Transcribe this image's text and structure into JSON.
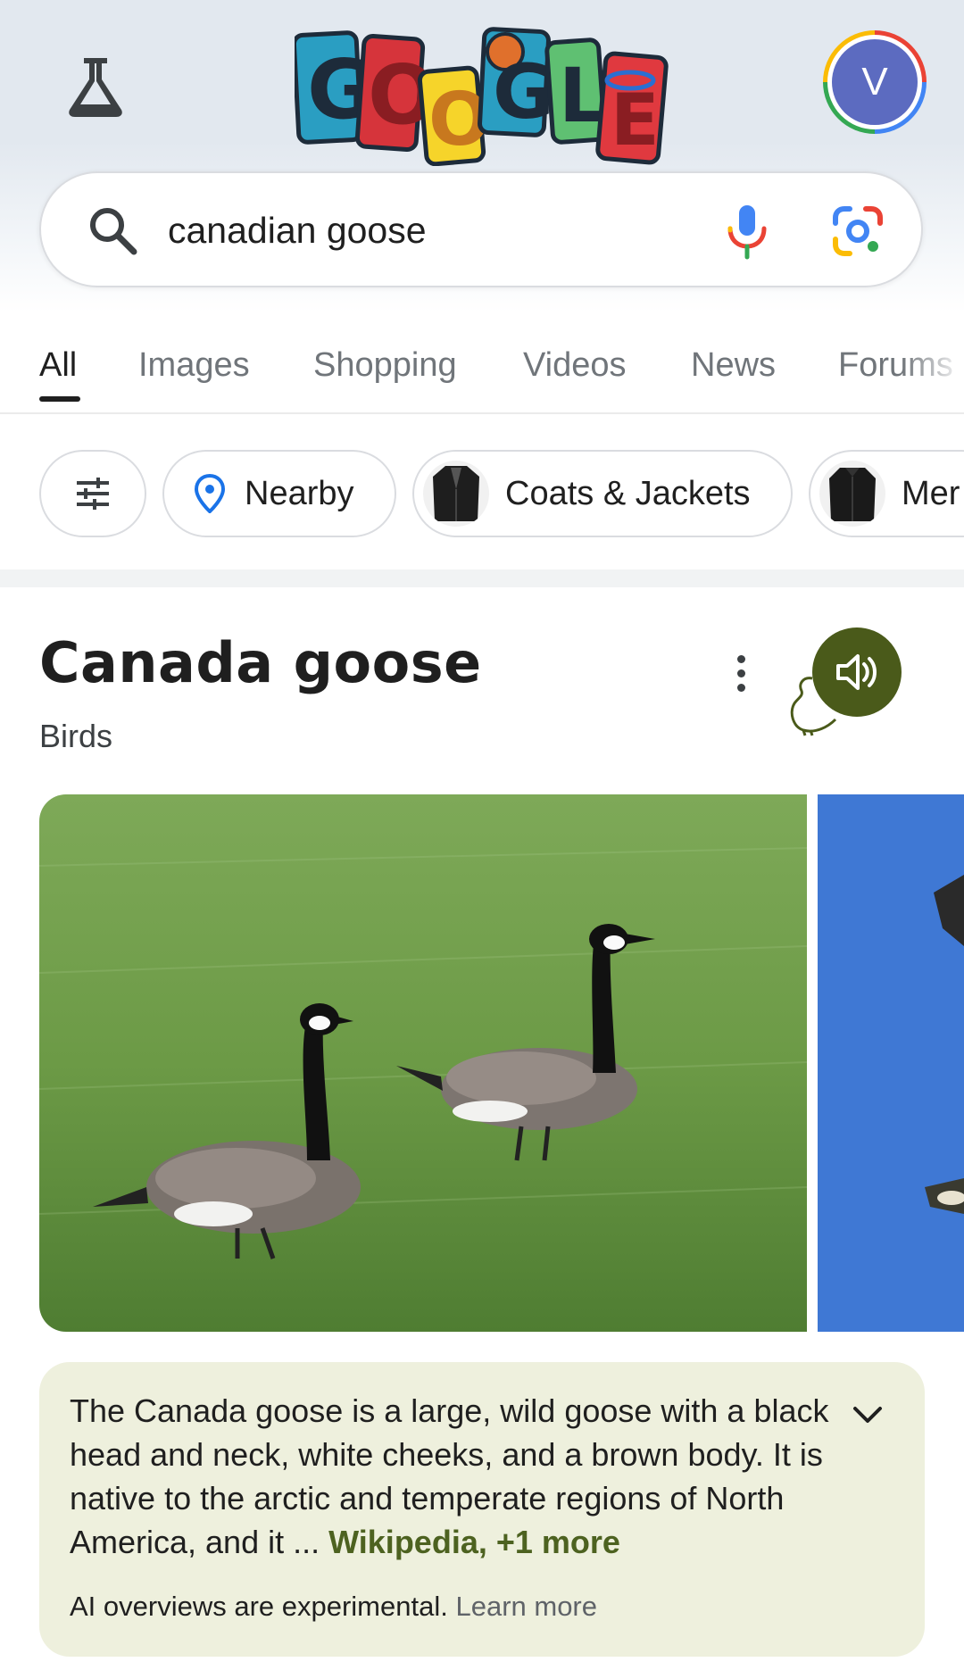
{
  "header": {
    "labs_icon": "flask-icon",
    "doodle_alt": "Google",
    "avatar_letter": "V",
    "avatar_color": "#5c6bc0"
  },
  "search": {
    "query": "canadian goose",
    "search_icon": "search-icon",
    "mic_icon": "mic-icon",
    "lens_icon": "google-lens-icon"
  },
  "tabs": [
    {
      "label": "All",
      "active": true
    },
    {
      "label": "Images"
    },
    {
      "label": "Shopping"
    },
    {
      "label": "Videos"
    },
    {
      "label": "News"
    },
    {
      "label": "Forums"
    }
  ],
  "chips": [
    {
      "label": "",
      "icon": "filter-sliders-icon"
    },
    {
      "label": "Nearby",
      "icon": "location-pin-icon"
    },
    {
      "label": "Coats & Jackets",
      "icon": "jacket-thumbnail"
    },
    {
      "label": "Mer",
      "icon": "jacket-thumbnail"
    }
  ],
  "knowledge_panel": {
    "title": "Canada goose",
    "subtitle": "Birds",
    "more_icon": "more-vert-icon",
    "audio_icon": "volume-icon"
  },
  "ai_overview": {
    "text": "The Canada goose is a large, wild goose with a black head and neck, white cheeks, and a brown body. It is native to the arctic and temperate regions of North America, and it",
    "ellipsis": " ... ",
    "source_link": "Wikipedia, +1 more",
    "note": "AI overviews are experimental.",
    "learn_more": "Learn more",
    "background_color": "#eef0dd",
    "link_color": "#4d6220"
  }
}
